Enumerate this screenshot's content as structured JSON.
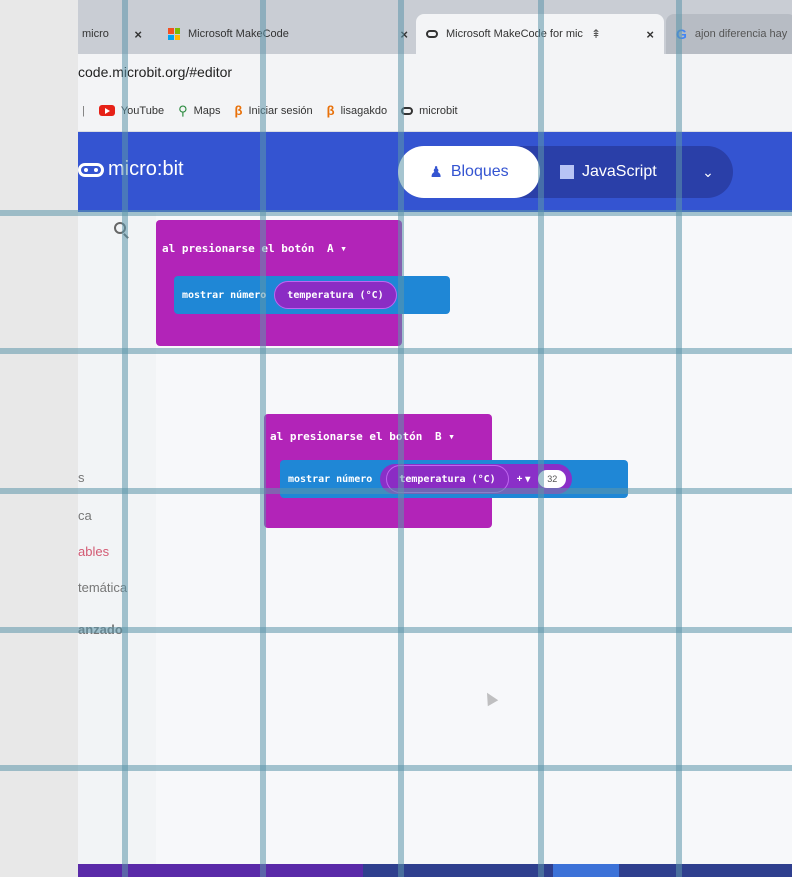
{
  "browser": {
    "tabs": [
      {
        "label": "micro",
        "active": false
      },
      {
        "label": "Microsoft MakeCode",
        "active": false
      },
      {
        "label": "Microsoft MakeCode for mic",
        "active": true
      },
      {
        "label": "ajon diferencia hay",
        "active": false
      }
    ],
    "url": "code.microbit.org/#editor",
    "bookmarks": [
      "YouTube",
      "Maps",
      "Iniciar sesión",
      "lisagakdo",
      "microbit"
    ]
  },
  "makecode": {
    "logo_text": "micro:bit",
    "blocks_label": "Bloques",
    "js_label": "JavaScript",
    "more_icon": "chevron-down-icon"
  },
  "toolbox": {
    "categories": [
      "s",
      "ca",
      "ables",
      "temática",
      "anzado"
    ]
  },
  "blocks": [
    {
      "event": "al presionarse el botón",
      "button": "A",
      "dropdown": "▾",
      "statement": "mostrar número",
      "reporter": "temperatura (°C)"
    },
    {
      "event": "al presionarse el botón",
      "button": "B",
      "dropdown": "▾",
      "statement": "mostrar número",
      "reporter": "temperatura (°C)",
      "operator": "+ ▾",
      "operand": "32"
    }
  ],
  "colors": {
    "makecode_blue": "#3454d1",
    "event_magenta": "#b224b8",
    "basic_blue": "#1f87d6",
    "sensor_purple": "#8b2cc4",
    "variables_red": "#d35a73"
  }
}
